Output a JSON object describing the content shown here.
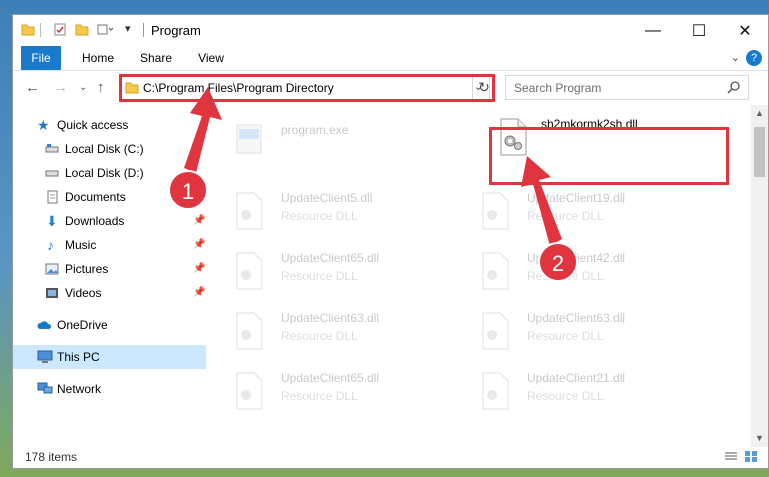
{
  "window": {
    "title": "Program"
  },
  "ribbon": {
    "tabs": [
      "File",
      "Home",
      "Share",
      "View"
    ]
  },
  "nav": {
    "address": "C:\\Program Files\\Program Directory",
    "search_placeholder": "Search Program"
  },
  "sidebar": {
    "items": [
      {
        "label": "Quick access",
        "icon": "star-icon"
      },
      {
        "label": "Local Disk (C:)",
        "icon": "drive-icon"
      },
      {
        "label": "Local Disk (D:)",
        "icon": "drive-icon"
      },
      {
        "label": "Documents",
        "icon": "documents-icon"
      },
      {
        "label": "Downloads",
        "icon": "download-icon"
      },
      {
        "label": "Music",
        "icon": "music-icon"
      },
      {
        "label": "Pictures",
        "icon": "pictures-icon"
      },
      {
        "label": "Videos",
        "icon": "videos-icon"
      },
      {
        "label": "OneDrive",
        "icon": "cloud-icon"
      },
      {
        "label": "This PC",
        "icon": "computer-icon"
      },
      {
        "label": "Network",
        "icon": "network-icon"
      }
    ]
  },
  "files": [
    {
      "name": "program.exe",
      "type": ""
    },
    {
      "name": "sh2mkormk2sh.dll",
      "type": ""
    },
    {
      "name": "UpdateClient5.dll",
      "type": "Resource DLL"
    },
    {
      "name": "UpdateClient19.dll",
      "type": "Resource DLL"
    },
    {
      "name": "UpdateClient65.dll",
      "type": "Resource DLL"
    },
    {
      "name": "UpdateClient42.dll",
      "type": "Resource DLL"
    },
    {
      "name": "UpdateClient63.dll",
      "type": "Resource DLL"
    },
    {
      "name": "UpdateClient63.dll",
      "type": "Resource DLL"
    },
    {
      "name": "UpdateClient65.dll",
      "type": "Resource DLL"
    },
    {
      "name": "UpdateClient21.dll",
      "type": "Resource DLL"
    }
  ],
  "status": {
    "item_count": "178 items"
  },
  "callouts": [
    "1",
    "2"
  ],
  "colors": {
    "accent": "#1979ca",
    "highlight": "#e0343f",
    "selected": "#cce8ff"
  }
}
